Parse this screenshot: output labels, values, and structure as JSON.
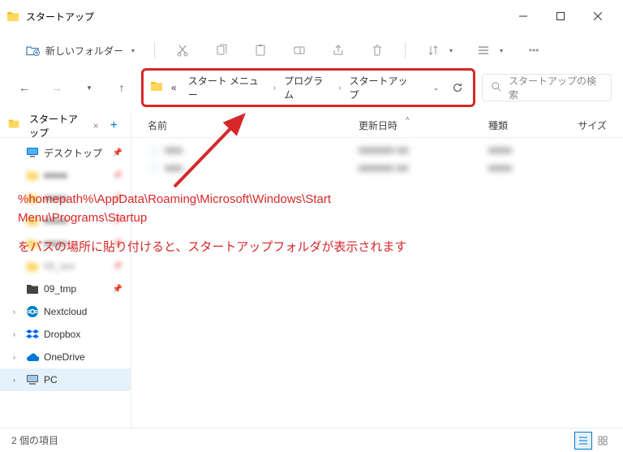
{
  "window": {
    "title": "スタートアップ"
  },
  "toolbar": {
    "new_folder": "新しいフォルダー"
  },
  "breadcrumb": {
    "overflow": "«",
    "items": [
      "スタート メニュー",
      "プログラム",
      "スタートアップ"
    ]
  },
  "search": {
    "placeholder": "スタートアップの検索"
  },
  "tab": {
    "label": "スタートアップ"
  },
  "sidebar": {
    "items": [
      {
        "label": "デスクトップ",
        "pinned": true,
        "icon": "desktop",
        "color": "#0078d4"
      },
      {
        "label": "■■■■",
        "pinned": true,
        "blur": true,
        "icon": "folder"
      },
      {
        "label": "■■■■",
        "pinned": true,
        "blur": true,
        "icon": "folder"
      },
      {
        "label": "■■■■",
        "pinned": true,
        "blur": true,
        "icon": "folder"
      },
      {
        "label": "■■■■",
        "pinned": true,
        "blur": true,
        "icon": "folder"
      },
      {
        "label": "03_svn",
        "pinned": true,
        "blur": true,
        "icon": "folder"
      },
      {
        "label": "09_tmp",
        "pinned": true,
        "icon": "folder-dark"
      },
      {
        "label": "Nextcloud",
        "expandable": true,
        "icon": "nextcloud",
        "color": "#0082c9"
      },
      {
        "label": "Dropbox",
        "expandable": true,
        "icon": "dropbox",
        "color": "#0061ff"
      },
      {
        "label": "OneDrive",
        "expandable": true,
        "icon": "onedrive",
        "color": "#0078d4"
      },
      {
        "label": "PC",
        "expandable": true,
        "active": true,
        "icon": "pc",
        "color": "#5a5a5a"
      }
    ]
  },
  "columns": {
    "name": "名前",
    "date": "更新日時",
    "type": "種類",
    "size": "サイズ"
  },
  "files": [
    {
      "name": "■■■",
      "date": "■■■■■■ ■■",
      "type": "■■■■"
    },
    {
      "name": "■■■",
      "date": "■■■■■■ ■■",
      "type": "■■■■"
    }
  ],
  "annotation": {
    "path_line1": "%homepath%\\AppData\\Roaming\\Microsoft\\Windows\\Start",
    "path_line2": "Menu\\Programs\\Startup",
    "jp": "をパスの場所に貼り付けると、スタートアップフォルダが表示されます"
  },
  "status": {
    "count": "2 個の項目"
  }
}
